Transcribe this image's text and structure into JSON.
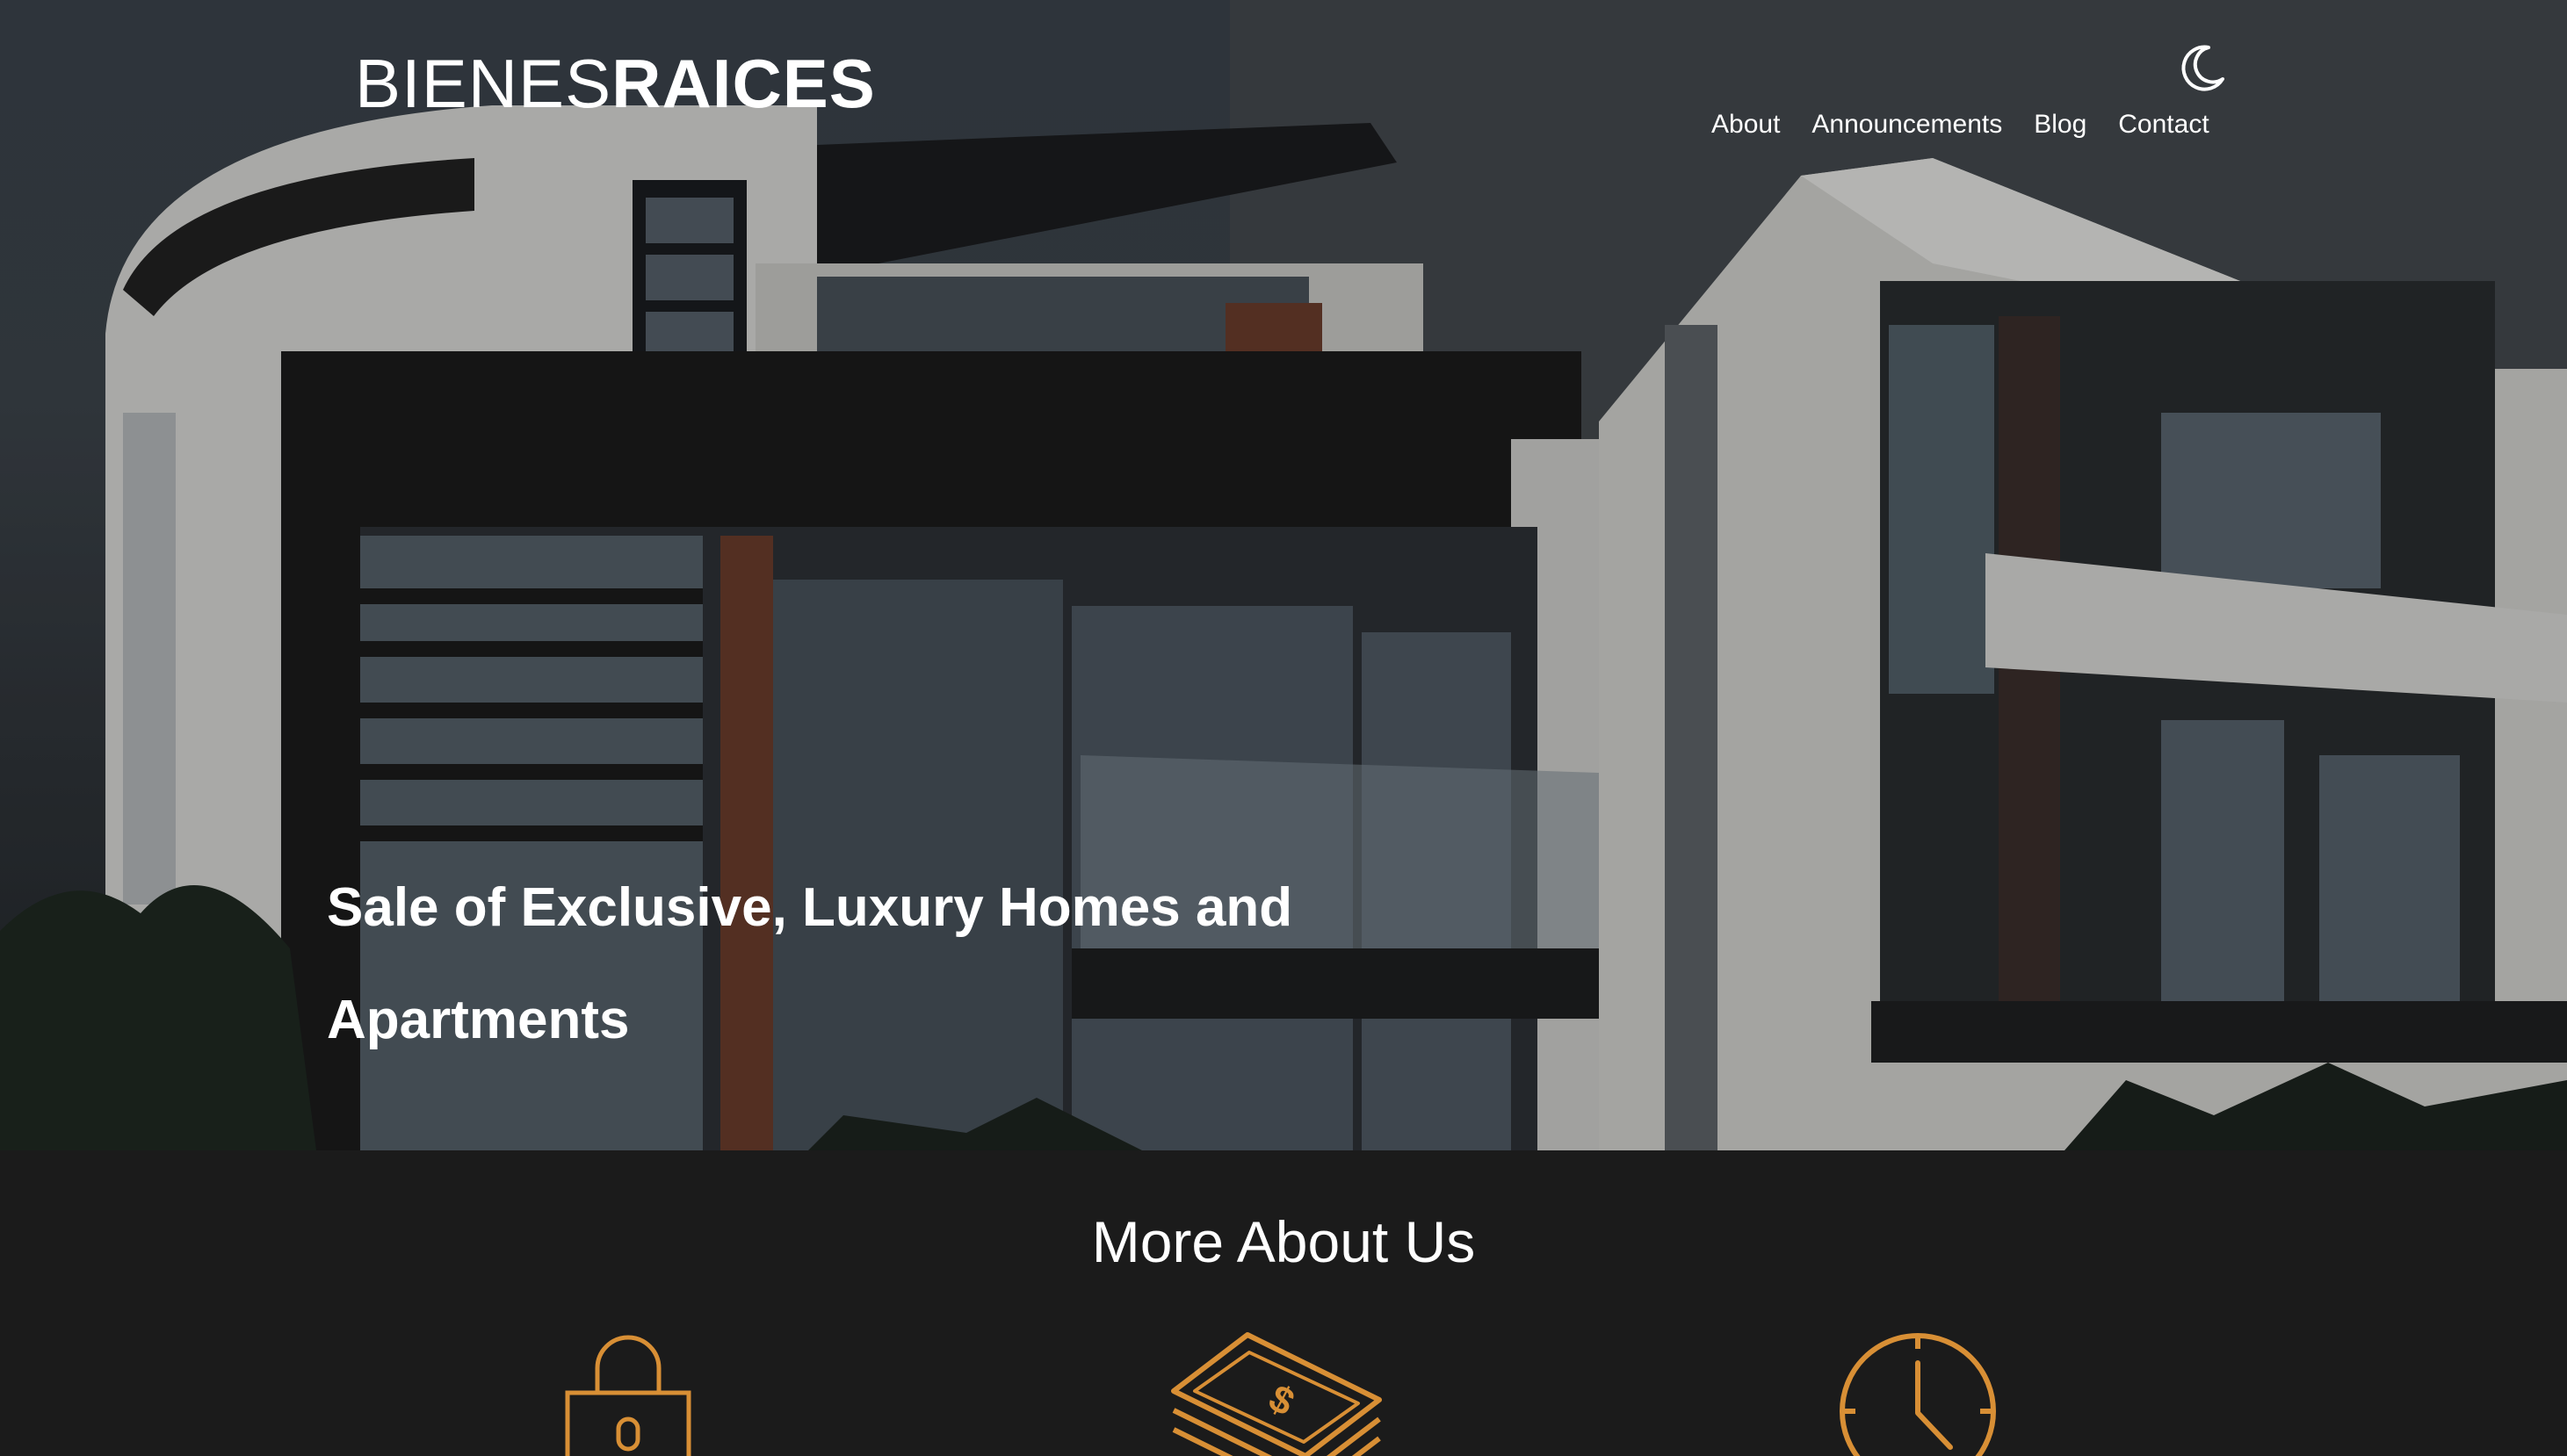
{
  "header": {
    "logo": {
      "light": "BIENES",
      "bold": "RAICES"
    },
    "theme_toggle_icon": "moon-icon",
    "nav": [
      {
        "label": "About"
      },
      {
        "label": "Announcements"
      },
      {
        "label": "Blog"
      },
      {
        "label": "Contact"
      }
    ]
  },
  "hero": {
    "title": "Sale of Exclusive, Luxury Homes and Apartments"
  },
  "about": {
    "title": "More About Us",
    "features": [
      {
        "icon": "lock-icon"
      },
      {
        "icon": "money-stack-icon"
      },
      {
        "icon": "clock-icon"
      }
    ]
  },
  "colors": {
    "accent": "#d88f35",
    "section_bg": "#1b1b1b",
    "text": "#ffffff"
  }
}
